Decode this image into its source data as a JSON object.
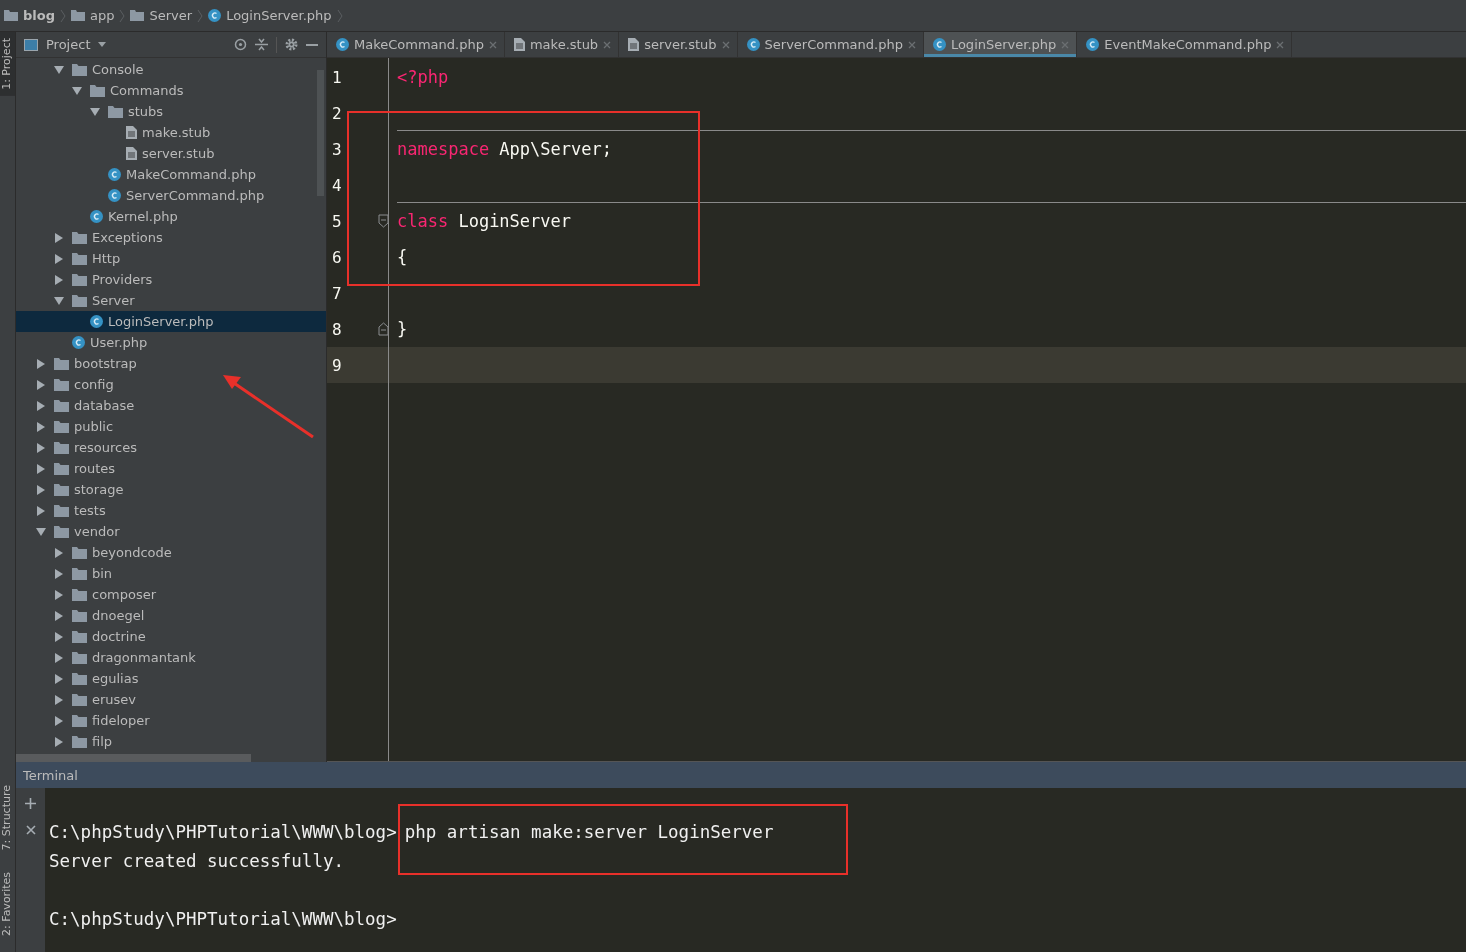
{
  "breadcrumb": [
    {
      "label": "blog",
      "kind": "folder",
      "bold": true
    },
    {
      "label": "app",
      "kind": "folder",
      "bold": false
    },
    {
      "label": "Server",
      "kind": "folder",
      "bold": false
    },
    {
      "label": "LoginServer.php",
      "kind": "php",
      "bold": false
    }
  ],
  "side_tabs": [
    {
      "label": "1: Project",
      "selected": true
    },
    {
      "label": "7: Structure",
      "selected": false
    },
    {
      "label": "2: Favorites",
      "selected": false
    }
  ],
  "project_panel": {
    "title": "Project"
  },
  "tree": [
    {
      "children": [
        {
          "label": "Console",
          "kind": "folder",
          "expanded": true,
          "selected": false,
          "children": [
            {
              "label": "Commands",
              "kind": "folder",
              "expanded": true,
              "selected": false,
              "children": [
                {
                  "label": "stubs",
                  "kind": "folder",
                  "expanded": true,
                  "selected": false,
                  "children": [
                    {
                      "label": "make.stub",
                      "kind": "stub",
                      "selected": false
                    },
                    {
                      "label": "server.stub",
                      "kind": "stub",
                      "selected": false
                    }
                  ]
                },
                {
                  "label": "MakeCommand.php",
                  "kind": "php",
                  "selected": false
                },
                {
                  "label": "ServerCommand.php",
                  "kind": "php",
                  "selected": false
                }
              ]
            },
            {
              "label": "Kernel.php",
              "kind": "php",
              "selected": false
            }
          ]
        },
        {
          "label": "Exceptions",
          "kind": "folder",
          "expanded": false,
          "selected": false
        },
        {
          "label": "Http",
          "kind": "folder",
          "expanded": false,
          "selected": false
        },
        {
          "label": "Providers",
          "kind": "folder",
          "expanded": false,
          "selected": false
        },
        {
          "label": "Server",
          "kind": "folder",
          "expanded": true,
          "selected": false,
          "children": [
            {
              "label": "LoginServer.php",
              "kind": "php",
              "selected": true
            }
          ]
        },
        {
          "label": "User.php",
          "kind": "php",
          "selected": false
        }
      ]
    },
    {
      "label": "bootstrap",
      "kind": "folder",
      "expanded": false,
      "selected": false
    },
    {
      "label": "config",
      "kind": "folder",
      "expanded": false,
      "selected": false
    },
    {
      "label": "database",
      "kind": "folder",
      "expanded": false,
      "selected": false
    },
    {
      "label": "public",
      "kind": "folder",
      "expanded": false,
      "selected": false
    },
    {
      "label": "resources",
      "kind": "folder",
      "expanded": false,
      "selected": false
    },
    {
      "label": "routes",
      "kind": "folder",
      "expanded": false,
      "selected": false
    },
    {
      "label": "storage",
      "kind": "folder",
      "expanded": false,
      "selected": false
    },
    {
      "label": "tests",
      "kind": "folder",
      "expanded": false,
      "selected": false
    },
    {
      "label": "vendor",
      "kind": "folder",
      "expanded": true,
      "selected": false,
      "children": [
        {
          "label": "beyondcode",
          "kind": "folder",
          "expanded": false,
          "selected": false
        },
        {
          "label": "bin",
          "kind": "folder",
          "expanded": false,
          "selected": false
        },
        {
          "label": "composer",
          "kind": "folder",
          "expanded": false,
          "selected": false
        },
        {
          "label": "dnoegel",
          "kind": "folder",
          "expanded": false,
          "selected": false
        },
        {
          "label": "doctrine",
          "kind": "folder",
          "expanded": false,
          "selected": false
        },
        {
          "label": "dragonmantank",
          "kind": "folder",
          "expanded": false,
          "selected": false
        },
        {
          "label": "egulias",
          "kind": "folder",
          "expanded": false,
          "selected": false
        },
        {
          "label": "erusev",
          "kind": "folder",
          "expanded": false,
          "selected": false
        },
        {
          "label": "fideloper",
          "kind": "folder",
          "expanded": false,
          "selected": false
        },
        {
          "label": "filp",
          "kind": "folder",
          "expanded": false,
          "selected": false
        }
      ]
    }
  ],
  "tabs": [
    {
      "label": "MakeCommand.php",
      "kind": "php",
      "selected": false
    },
    {
      "label": "make.stub",
      "kind": "stub",
      "selected": false
    },
    {
      "label": "server.stub",
      "kind": "stub",
      "selected": false
    },
    {
      "label": "ServerCommand.php",
      "kind": "php",
      "selected": false
    },
    {
      "label": "LoginServer.php",
      "kind": "php",
      "selected": true
    },
    {
      "label": "EventMakeCommand.php",
      "kind": "php",
      "selected": false
    }
  ],
  "editor": {
    "lines": [
      {
        "number": "1",
        "separator": false,
        "fold_start": false,
        "fold_end": false,
        "current": false,
        "tokens": [
          {
            "text": "<?php",
            "kind": "tag"
          }
        ]
      },
      {
        "number": "2",
        "separator": false,
        "fold_start": false,
        "fold_end": false,
        "current": false
      },
      {
        "number": "3",
        "separator": true,
        "fold_start": false,
        "fold_end": false,
        "current": false,
        "tokens": [
          {
            "text": "namespace",
            "kind": "keyword"
          },
          {
            "text": " App\\Server;",
            "kind": "plain"
          }
        ]
      },
      {
        "number": "4",
        "separator": false,
        "fold_start": false,
        "fold_end": false,
        "current": false
      },
      {
        "number": "5",
        "separator": true,
        "fold_start": true,
        "fold_end": false,
        "current": false,
        "tokens": [
          {
            "text": "class",
            "kind": "keyword"
          },
          {
            "text": " LoginServer",
            "kind": "plain"
          }
        ]
      },
      {
        "number": "6",
        "separator": false,
        "fold_start": false,
        "fold_end": false,
        "current": false,
        "tokens": [
          {
            "text": "{",
            "kind": "plain"
          }
        ]
      },
      {
        "number": "7",
        "separator": false,
        "fold_start": false,
        "fold_end": false,
        "current": false
      },
      {
        "number": "8",
        "separator": false,
        "fold_start": false,
        "fold_end": true,
        "current": false,
        "tokens": [
          {
            "text": "}",
            "kind": "plain"
          }
        ]
      },
      {
        "number": "9",
        "separator": false,
        "fold_start": false,
        "fold_end": false,
        "current": true
      }
    ]
  },
  "terminal": {
    "title": "Terminal",
    "lines": [
      {
        "kind": "prompt",
        "prompt": "C:\\phpStudy\\PHPTutorial\\WWW\\blog>",
        "command": "php artisan make:server LoginServer"
      },
      {
        "kind": "output",
        "text": "Server created successfully."
      },
      {
        "kind": "prompt",
        "prompt": "C:\\phpStudy\\PHPTutorial\\WWW\\blog>"
      }
    ]
  }
}
